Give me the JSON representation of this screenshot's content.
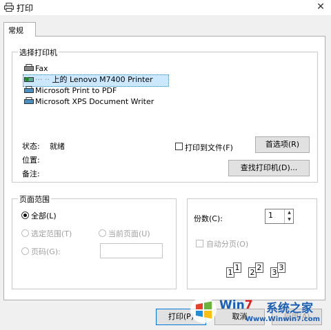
{
  "window": {
    "title": "打印"
  },
  "tabs": [
    {
      "label": "常规"
    }
  ],
  "select_printer": {
    "group_label": "选择打印机",
    "printers": [
      {
        "name": "Fax"
      },
      {
        "name": "上的 Lenovo M7400 Printer",
        "selected": true
      },
      {
        "name": "Microsoft Print to PDF"
      },
      {
        "name": "Microsoft XPS Document Writer"
      }
    ],
    "status_label": "状态:",
    "status_value": "就绪",
    "location_label": "位置:",
    "comment_label": "备注:",
    "print_to_file_label": "打印到文件(F)",
    "preferences_button": "首选项(R)",
    "find_printer_button": "查找打印机(D)..."
  },
  "page_range": {
    "group_label": "页面范围",
    "all_label": "全部(L)",
    "selection_label": "选定范围(T)",
    "current_page_label": "当前页面(U)",
    "pages_label": "页码(G):",
    "pages_value": ""
  },
  "copies": {
    "count_label": "份数(C):",
    "count_value": "1",
    "collate_label": "自动分页(O)",
    "collate_pages": [
      "1",
      "1",
      "2",
      "2",
      "3",
      "3"
    ]
  },
  "buttons": {
    "print": "打印(P)",
    "cancel": "取消",
    "apply": "应用(A)"
  },
  "watermark": {
    "brand_win": "Win",
    "brand_seven": "7",
    "brand_cn": "系统之家",
    "url": "Www.Winwin7.com"
  },
  "colors": {
    "accent": "#0078d7",
    "selection": "#cce8ff"
  }
}
